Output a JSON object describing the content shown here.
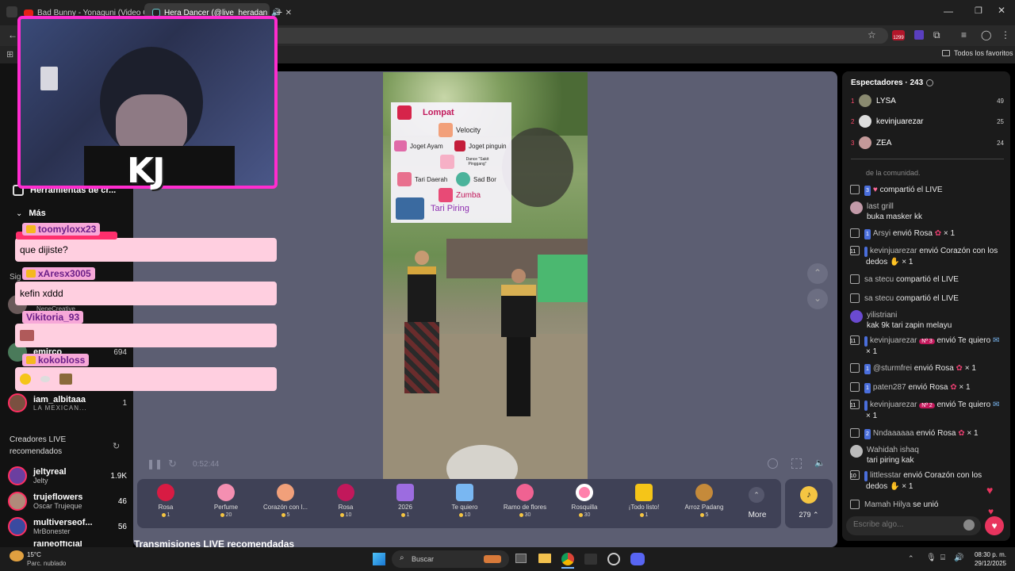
{
  "tabs": [
    {
      "title": "Bad Bunny - Yonaguni (Video O",
      "icon": "youtube-icon"
    },
    {
      "title": "Hera Dancer (@live_heradan",
      "icon": "tiktok-icon"
    }
  ],
  "toolbar": {
    "ext_badge": "1299"
  },
  "bookmarks": {
    "all_label": "Todos los favoritos"
  },
  "webcam": {
    "overlay_text": "KJ"
  },
  "leftnav": {
    "tools_label": "Herramientas de cr...",
    "more_label": "Más",
    "following_label": "Sig",
    "followed": [
      {
        "name": "NeneCreative",
        "sub": "",
        "count": ""
      },
      {
        "name": "emirco",
        "sub": "",
        "count": "694"
      },
      {
        "name": "iam_albitaaa",
        "sub": "LA MEXICAN...",
        "count": "1"
      }
    ],
    "recommended_title": "Creadores LIVE recomendados",
    "recommended": [
      {
        "name": "jeltyreal",
        "sub": "Jelty",
        "count": "1.9K"
      },
      {
        "name": "trujeflowers",
        "sub": "Oscar Trujeque",
        "count": "46"
      },
      {
        "name": "multiverseof...",
        "sub": "MrBonester",
        "count": "56"
      },
      {
        "name": "raineofficial",
        "sub": "",
        "count": ""
      }
    ]
  },
  "overlay_chat": [
    {
      "user": "toomyloxx23",
      "text": "que dijiste?"
    },
    {
      "user": "xAresx3005",
      "text": "kefin xddd"
    },
    {
      "user": "Vikitoria_93",
      "text": ""
    },
    {
      "user": "kokobloss",
      "text": ""
    }
  ],
  "video": {
    "menu": [
      {
        "label": "Lompat",
        "color": "#d6244a"
      },
      {
        "label": "Velocity",
        "color": "#f2a07a"
      },
      {
        "label": "Joget Ayam",
        "color": "#e06aa8"
      },
      {
        "label": "Joget pinguin",
        "color": "#c41d3a"
      },
      {
        "label": "Dance \"Sakit Pinggang\"",
        "color": "#f6b0c6"
      },
      {
        "label": "Tari Daerah",
        "color": "#e8708e"
      },
      {
        "label": "Sad Bor",
        "color": "#4bb39b"
      },
      {
        "label": "Zumba",
        "color": "#e84a76"
      },
      {
        "label": "Tari Piring",
        "color": "#3a6aa0"
      }
    ]
  },
  "player": {
    "time": "0:52:44"
  },
  "gifts": [
    {
      "name": "Rosa",
      "price": "1",
      "color": "#d81b43"
    },
    {
      "name": "Perfume",
      "price": "20",
      "color": "#f48fb1"
    },
    {
      "name": "Corazón con l...",
      "price": "5",
      "color": "#f1a07a"
    },
    {
      "name": "Rosa",
      "price": "10",
      "color": "#c2185b"
    },
    {
      "name": "2026",
      "price": "1",
      "color": "#9c6ce0"
    },
    {
      "name": "Te quiero",
      "price": "10",
      "color": "#79b7f2"
    },
    {
      "name": "Ramo de flores",
      "price": "30",
      "color": "#f06292"
    },
    {
      "name": "Rosquilla",
      "price": "30",
      "color": "#ff80ab"
    },
    {
      "name": "¡Todo listo!",
      "price": "1",
      "color": "#f5c518"
    },
    {
      "name": "Arroz Padang",
      "price": "5",
      "color": "#c58a3a"
    }
  ],
  "gifts_more": "More",
  "coins": "279",
  "recommended_heading": "Transmisiones LIVE recomendadas",
  "viewers": {
    "title": "Espectadores · 243",
    "top": [
      {
        "rank": "1",
        "name": "LYSA",
        "score": "49"
      },
      {
        "rank": "2",
        "name": "kevinjuarezar",
        "score": "25"
      },
      {
        "rank": "3",
        "name": "ZEA",
        "score": "24"
      }
    ]
  },
  "chat": [
    {
      "kind": "sys",
      "text": "de la comunidad."
    },
    {
      "kind": "share",
      "level": "3",
      "user": "",
      "text": "compartió el LIVE"
    },
    {
      "kind": "msg",
      "user": "last grill",
      "text": "buka masker kk"
    },
    {
      "kind": "gift",
      "level": "1",
      "user": "Arsyi",
      "text": "envió Rosa",
      "count": "× 1"
    },
    {
      "kind": "gift",
      "level": "11",
      "user": "kevinjuarezar",
      "text": "envió Corazón con los dedos",
      "count": "× 1"
    },
    {
      "kind": "share",
      "level": "",
      "user": "sa stecu",
      "text": "compartió el LIVE"
    },
    {
      "kind": "share",
      "level": "",
      "user": "sa stecu",
      "text": "compartió el LIVE"
    },
    {
      "kind": "msg",
      "user": "yilistriani",
      "text": "kak 9k tari zapin melayu"
    },
    {
      "kind": "gift",
      "level": "11",
      "user": "kevinjuarezar",
      "tag": "Nº 3",
      "text": "envió Te quiero",
      "count": "× 1"
    },
    {
      "kind": "gift",
      "level": "1",
      "user": "@sturmfrei",
      "text": "envió Rosa",
      "count": "× 1"
    },
    {
      "kind": "gift",
      "level": "1",
      "user": "paten287",
      "text": "envió Rosa",
      "count": "× 1"
    },
    {
      "kind": "gift",
      "level": "11",
      "user": "kevinjuarezar",
      "tag": "Nº 2",
      "text": "envió Te quiero",
      "count": "× 1"
    },
    {
      "kind": "gift",
      "level": "2",
      "user": "Nndaaaaaa",
      "text": "envió Rosa",
      "count": "× 1"
    },
    {
      "kind": "msg",
      "user": "Wahidah ishaq",
      "text": "tari piring kak"
    },
    {
      "kind": "gift",
      "level": "10",
      "user": "littlesstar",
      "text": "envió Corazón con los dedos",
      "count": "× 1"
    },
    {
      "kind": "join",
      "level": "",
      "user": "Mamah Hilya",
      "text": "se unió"
    }
  ],
  "chat_input": {
    "placeholder": "Escribe algo..."
  },
  "taskbar": {
    "weather_temp": "15°C",
    "weather_desc": "Parc. nublado",
    "search_label": "Buscar",
    "time": "08:30 p. m.",
    "date": "29/12/2025"
  }
}
